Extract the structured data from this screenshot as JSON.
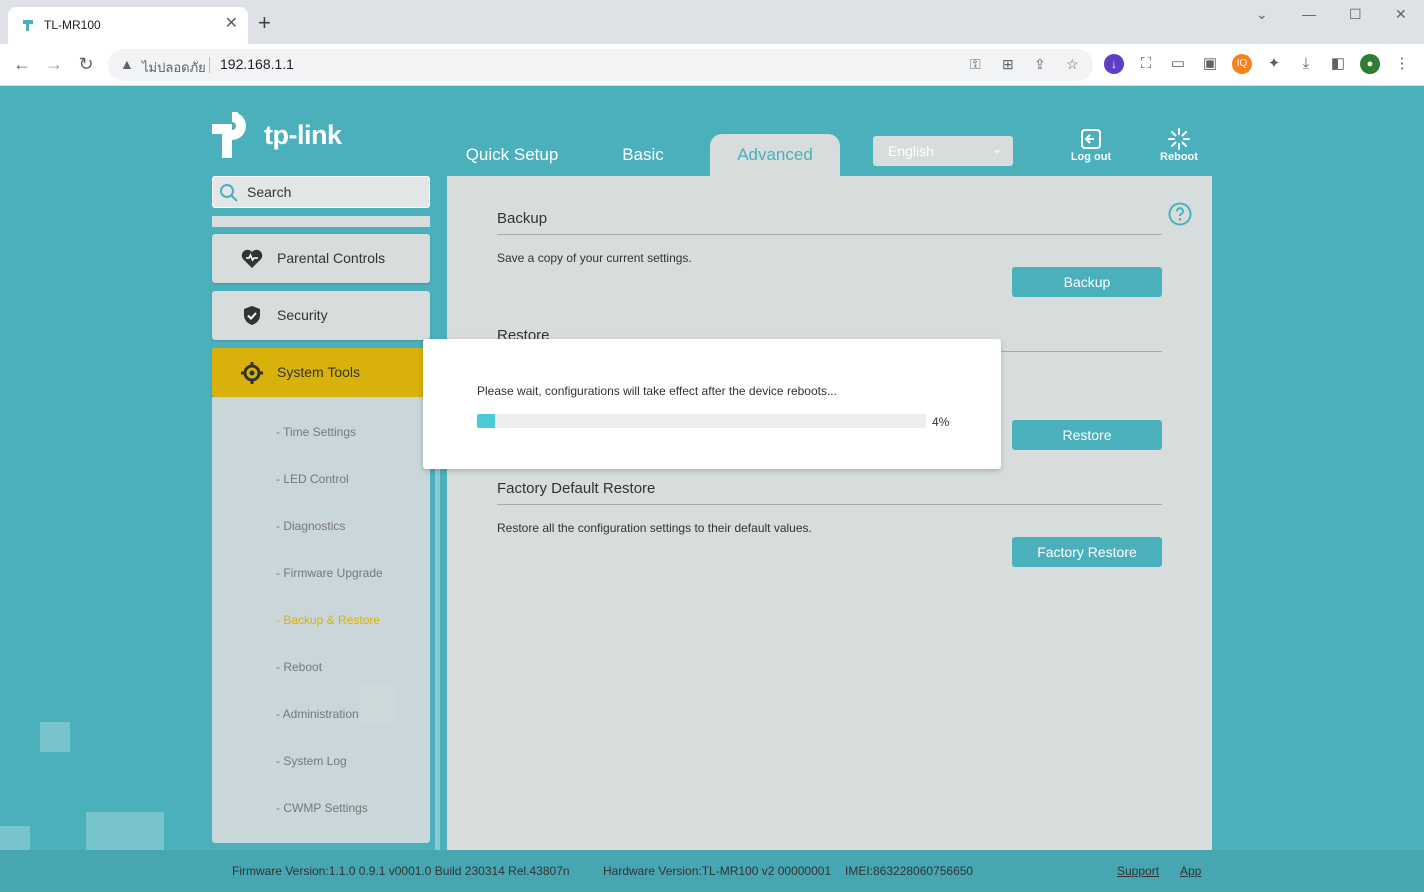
{
  "browser": {
    "tab_title": "TL-MR100",
    "security_label": "ไม่ปลอดภัย",
    "url": "192.168.1.1"
  },
  "header": {
    "logo_text": "tp-link",
    "tabs": [
      {
        "label": "Quick Setup"
      },
      {
        "label": "Basic"
      },
      {
        "label": "Advanced"
      }
    ],
    "active_tab": "Advanced",
    "language": "English",
    "logout_label": "Log out",
    "reboot_label": "Reboot"
  },
  "sidebar": {
    "search_placeholder": "Search",
    "menu": [
      {
        "label": "Parental Controls",
        "icon": "heart-icon"
      },
      {
        "label": "Security",
        "icon": "shield-icon"
      },
      {
        "label": "System Tools",
        "icon": "gear-icon"
      }
    ],
    "submenu": [
      {
        "label": "- Time Settings"
      },
      {
        "label": "- LED Control"
      },
      {
        "label": "- Diagnostics"
      },
      {
        "label": "- Firmware Upgrade"
      },
      {
        "label": "- Backup & Restore"
      },
      {
        "label": "- Reboot"
      },
      {
        "label": "- Administration"
      },
      {
        "label": "- System Log"
      },
      {
        "label": "- CWMP Settings"
      }
    ],
    "active_submenu": "- Backup & Restore"
  },
  "content": {
    "backup": {
      "title": "Backup",
      "description": "Save a copy of your current settings.",
      "button": "Backup"
    },
    "restore": {
      "title": "Restore",
      "button": "Restore"
    },
    "factory": {
      "title": "Factory Default Restore",
      "description": "Restore all the configuration settings to their default values.",
      "button": "Factory Restore"
    }
  },
  "modal": {
    "message": "Please wait, configurations will take effect after the device reboots...",
    "progress": 0.04,
    "progress_label": "4%"
  },
  "footer": {
    "firmware": "Firmware Version:1.1.0 0.9.1 v0001.0 Build 230314 Rel.43807n",
    "hardware": "Hardware Version:TL-MR100 v2 00000001",
    "imei": "IMEI:863228060756650",
    "support": "Support",
    "app": "App"
  },
  "colors": {
    "brand": "#4ab0bc",
    "active_menu": "#d8b20a",
    "progress": "#4cc9d6"
  }
}
